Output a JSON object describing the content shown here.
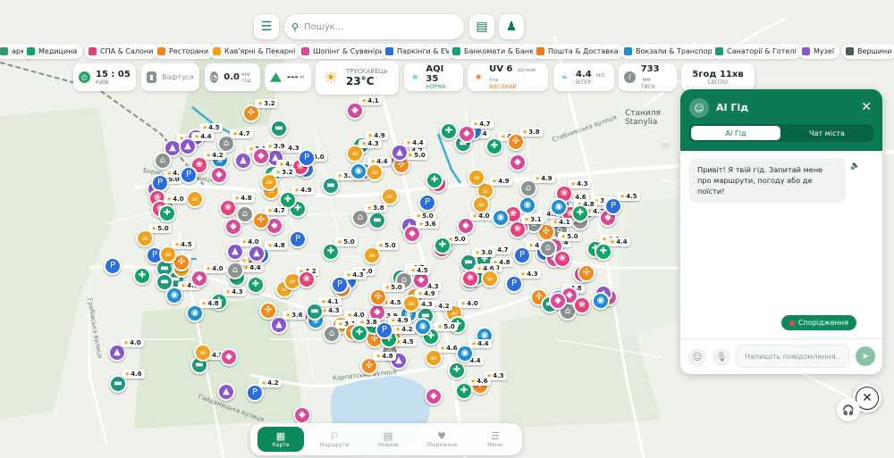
{
  "top_bar": {
    "menu_icon": "menu-icon",
    "search_placeholder": "Пошук...",
    "news_icon": "newspaper-icon",
    "profile_icon": "user-icon"
  },
  "categories": [
    {
      "label": "арки",
      "color": "#2f9e6b"
    },
    {
      "label": "Медицина",
      "color": "#12a36b"
    },
    {
      "label": "СПА & Салони",
      "color": "#e8407a"
    },
    {
      "label": "Ресторани",
      "color": "#f08a1c"
    },
    {
      "label": "Кав'ярні & Пекарні",
      "color": "#f0a21c"
    },
    {
      "label": "Шопінг & Сувеніри",
      "color": "#d94a9a"
    },
    {
      "label": "Паркінги & EV",
      "color": "#2a6de0"
    },
    {
      "label": "Банкомати & Банки",
      "color": "#13a36d"
    },
    {
      "label": "Пошта & Доставка",
      "color": "#f07a1c"
    },
    {
      "label": "Вокзали & Транспорт",
      "color": "#1e8fd0"
    },
    {
      "label": "Санаторії & Готелі",
      "color": "#1e9a7a"
    },
    {
      "label": "Музеї",
      "color": "#8a56d0"
    },
    {
      "label": "Вершини",
      "color": "#4a5a55"
    }
  ],
  "widgets": {
    "time": {
      "value": "15 : 05",
      "sub": "київ"
    },
    "fuel": {
      "value": "Вафтуся"
    },
    "wind_speed": {
      "value": "0.0",
      "unit": "км/год"
    },
    "altitude": {
      "value": "---",
      "unit": "м"
    },
    "weather": {
      "city": "ТРУСКАВЕЦЬ",
      "temp": "23°C"
    },
    "aqi": {
      "value": "AQI 35",
      "sub": "НОРМА"
    },
    "uv": {
      "value": "UV 6",
      "sub": "ВИСОКИЙ",
      "extra": "Шуткий тінь"
    },
    "wind": {
      "value": "4.4",
      "unit": "м/с",
      "sub": "ВІТЕР"
    },
    "pressure": {
      "value": "733",
      "unit": "мм",
      "sub": "ТИСК"
    },
    "daylight": {
      "value": "5год 11хв",
      "sub": "СВІТЛО"
    }
  },
  "map": {
    "place_stanylia": "Станиля\nStanylia",
    "road_labels": [
      "Стебникська вулиця",
      "Грабівська вулиця",
      "Гайдамацька вулиця",
      "Бориславська вулиця",
      "Карпатська вулиця"
    ],
    "marker_ratings": [
      "3.8",
      "4.5",
      "4.7",
      "4.4",
      "4.0",
      "5.0",
      "4.9",
      "3.1",
      "4.3",
      "4.4",
      "4.2",
      "5.0",
      "4.8",
      "4.6",
      "3.8",
      "4.1",
      "4.3",
      "4.5",
      "4.0",
      "5.0",
      "4.4",
      "4.9",
      "3.7",
      "4.2",
      "4.6",
      "4.8",
      "5.0",
      "4.3",
      "3.9",
      "4.7",
      "4.0",
      "4.4",
      "5.0",
      "4.2",
      "3.6",
      "4.5",
      "4.8",
      "4.1",
      "4.0",
      "3.0",
      "4.3",
      "4.7",
      "4.6",
      "4.9",
      "3.2",
      "4.4",
      "4.5"
    ]
  },
  "bottom_nav": [
    {
      "label": "Карта",
      "icon": "map-icon",
      "active": true
    },
    {
      "label": "Маршрути",
      "icon": "route-icon"
    },
    {
      "label": "Новини",
      "icon": "news-icon"
    },
    {
      "label": "Збережене",
      "icon": "heart-icon"
    },
    {
      "label": "Меню",
      "icon": "menu-icon"
    }
  ],
  "ai_panel": {
    "title": "AI Гід",
    "tabs": [
      "AI Гід",
      "Чат міста"
    ],
    "greeting": "Привіт! Я твій гід. Запитай мене про маршрути, погоду або де поїсти!",
    "suggest_label": "Спорідження",
    "input_placeholder": "Напишіть повідомлення..."
  },
  "colors": {
    "brand": "#0c7a52",
    "accent": "#0c8a5a",
    "water": "#c3dff0"
  }
}
